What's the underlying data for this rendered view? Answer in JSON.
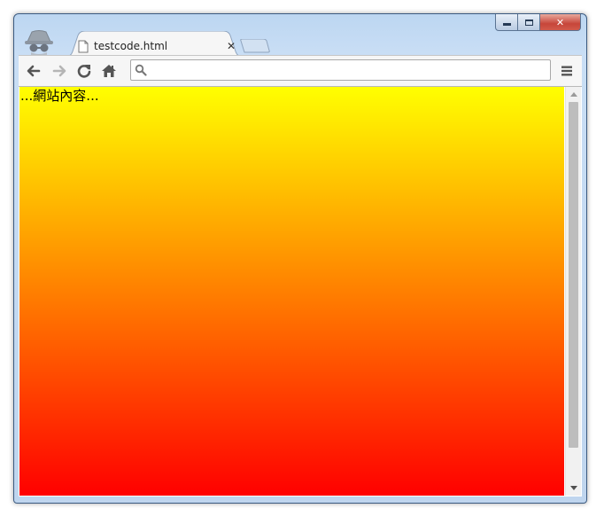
{
  "browser": {
    "tab": {
      "title": "testcode.html"
    },
    "omnibox": {
      "value": "",
      "placeholder": ""
    },
    "accent": "#bcd6f1"
  },
  "page": {
    "text": "...網站內容...",
    "gradient": {
      "from": "#ffff00",
      "to": "#ff0000"
    }
  },
  "icons": {
    "back": "arrow-left",
    "forward": "arrow-right",
    "reload": "reload",
    "home": "home",
    "menu": "hamburger",
    "search": "magnifier",
    "incognito": "spy"
  }
}
